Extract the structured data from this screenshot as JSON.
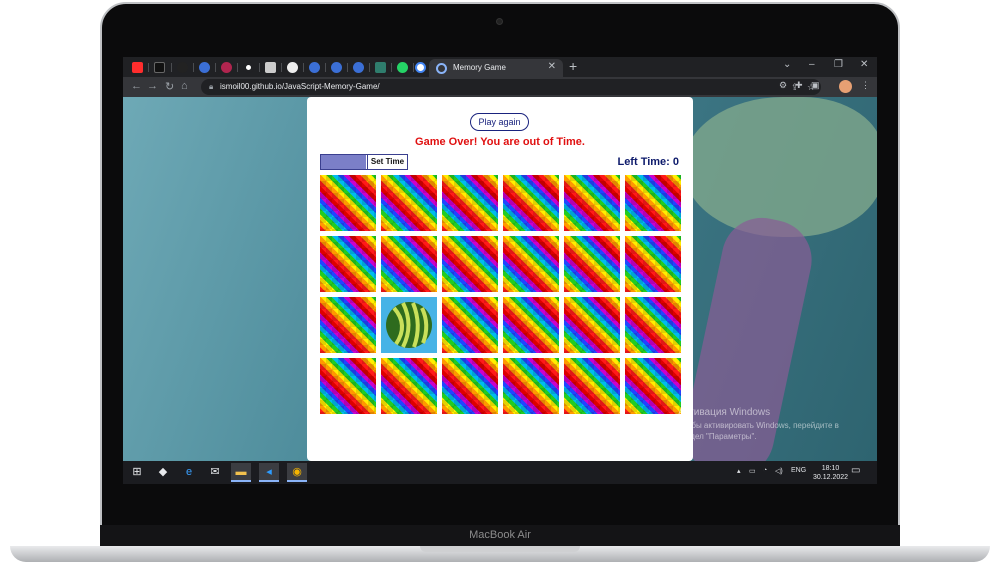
{
  "device": {
    "brand_label": "MacBook Air"
  },
  "browser": {
    "active_tab_title": "Memory Game",
    "url": "ismoil00.github.io/JavaScript-Memory-Game/",
    "window_controls": {
      "minimize": "–",
      "maximize": "❐",
      "close": "✕",
      "tab_search": "⌄"
    },
    "new_tab_symbol": "+"
  },
  "game": {
    "play_again_label": "Play again",
    "status_message": "Game Over! You are out of Time.",
    "set_time_label": "Set Time",
    "left_time_label": "Left Time: 0",
    "time_fill_fraction": 0.52,
    "cards": [
      "back",
      "back",
      "back",
      "back",
      "back",
      "back",
      "back",
      "back",
      "back",
      "back",
      "back",
      "back",
      "back",
      "watermelon",
      "back",
      "back",
      "back",
      "back",
      "back",
      "back",
      "back",
      "back",
      "back",
      "back"
    ]
  },
  "desktop": {
    "activation_title": "Активация Windows",
    "activation_text": "Чтобы активировать Windows, перейдите в раздел \"Параметры\"."
  },
  "taskbar": {
    "tray_lang": "ENG",
    "clock_time": "18:10",
    "clock_date": "30.12.2022"
  },
  "colors": {
    "status_red": "#e01010",
    "accent_navy": "#1a237e",
    "revealed_bg": "#46b3e6"
  }
}
